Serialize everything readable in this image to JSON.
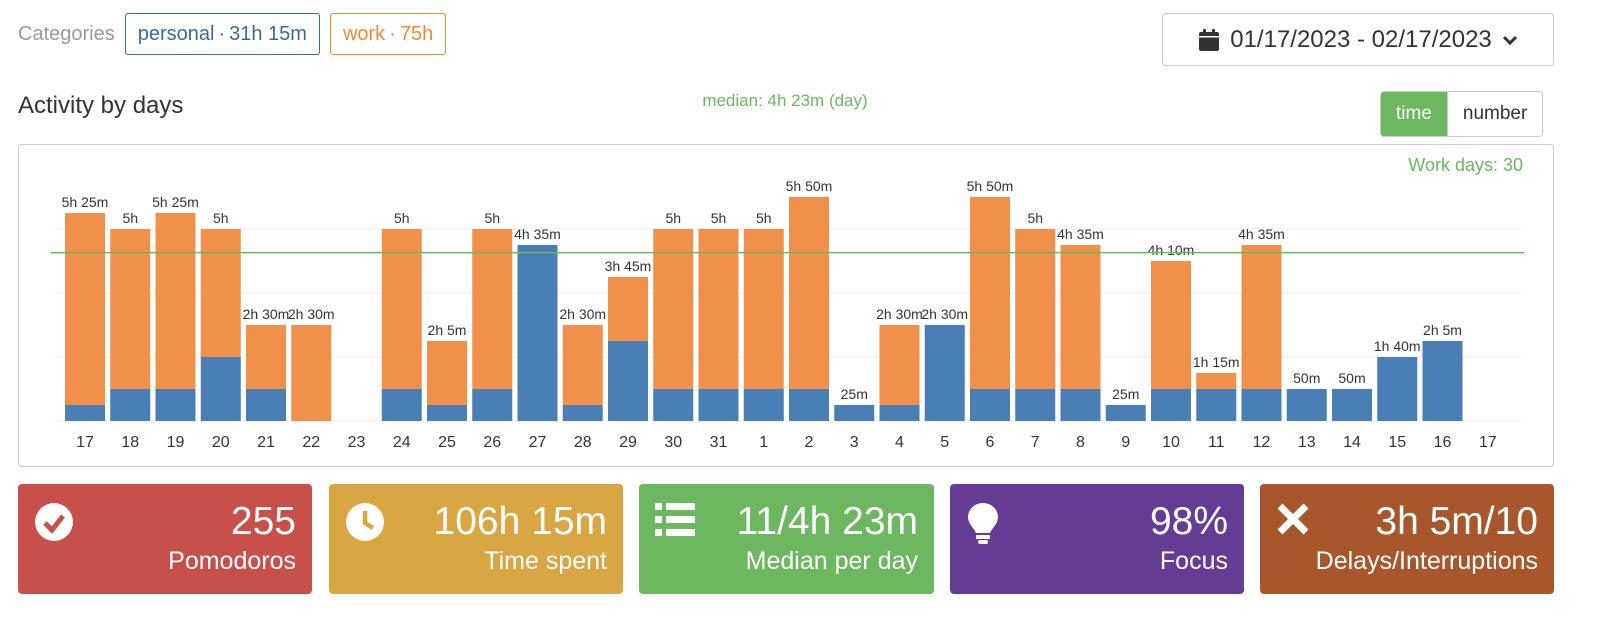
{
  "header": {
    "categories_label": "Categories",
    "chips": [
      {
        "name": "personal",
        "total": "31h 15m"
      },
      {
        "name": "work",
        "total": "75h"
      }
    ],
    "separator": "·",
    "date_range": "01/17/2023 - 02/17/2023"
  },
  "section_title": "Activity by days",
  "median_text": "median: 4h 23m (day)",
  "toggle": {
    "time": "time",
    "number": "number",
    "active": "time"
  },
  "work_days": "Work days: 30",
  "colors": {
    "personal": "#4a7fb5",
    "work": "#f0904a",
    "median": "#6cb760"
  },
  "chart_data": {
    "type": "bar",
    "stacked": true,
    "unit": "minutes",
    "categories": [
      "17",
      "18",
      "19",
      "20",
      "21",
      "22",
      "23",
      "24",
      "25",
      "26",
      "27",
      "28",
      "29",
      "30",
      "31",
      "1",
      "2",
      "3",
      "4",
      "5",
      "6",
      "7",
      "8",
      "9",
      "10",
      "11",
      "12",
      "13",
      "14",
      "15",
      "16",
      "17"
    ],
    "series": [
      {
        "name": "personal",
        "values": [
          25,
          50,
          50,
          100,
          50,
          0,
          0,
          50,
          25,
          50,
          275,
          25,
          125,
          50,
          50,
          50,
          50,
          25,
          25,
          150,
          50,
          50,
          50,
          25,
          50,
          50,
          50,
          50,
          50,
          100,
          125,
          0
        ]
      },
      {
        "name": "work",
        "values": [
          300,
          250,
          275,
          200,
          100,
          150,
          0,
          250,
          100,
          250,
          0,
          125,
          100,
          250,
          250,
          250,
          300,
          0,
          125,
          0,
          300,
          250,
          225,
          0,
          200,
          25,
          225,
          0,
          0,
          0,
          0,
          0
        ]
      }
    ],
    "totals_labels": [
      "5h 25m",
      "5h",
      "5h 25m",
      "5h",
      "2h 30m",
      "2h 30m",
      "",
      "5h",
      "2h 5m",
      "5h",
      "4h 35m",
      "2h 30m",
      "3h 45m",
      "5h",
      "5h",
      "5h",
      "5h 50m",
      "25m",
      "2h 30m",
      "2h 30m",
      "5h 50m",
      "5h",
      "4h 35m",
      "25m",
      "4h 10m",
      "1h 15m",
      "4h 35m",
      "50m",
      "50m",
      "1h 40m",
      "2h 5m",
      ""
    ],
    "median_line": 263,
    "ylim": [
      0,
      360
    ],
    "grid": true
  },
  "cards": [
    {
      "value": "255",
      "label": "Pomodoros",
      "color": "#c7504a",
      "icon": "check-circle-icon"
    },
    {
      "value": "106h 15m",
      "label": "Time spent",
      "color": "#d9a644",
      "icon": "clock-icon"
    },
    {
      "value": "11/4h 23m",
      "label": "Median per day",
      "color": "#6cb760",
      "icon": "list-icon"
    },
    {
      "value": "98%",
      "label": "Focus",
      "color": "#653c94",
      "icon": "lightbulb-icon"
    },
    {
      "value": "3h 5m/10",
      "label": "Delays/Interruptions",
      "color": "#a8572c",
      "icon": "times-icon"
    }
  ]
}
